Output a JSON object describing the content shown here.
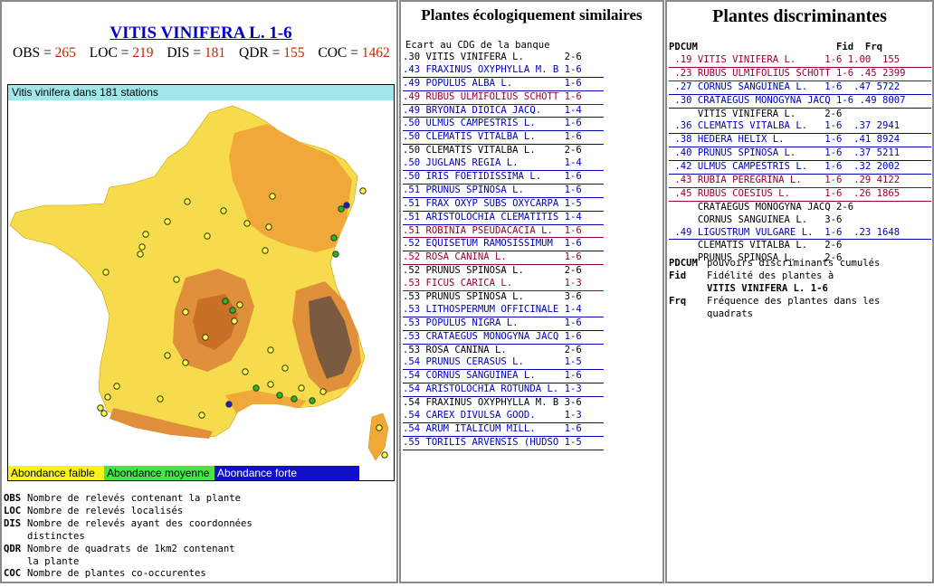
{
  "left": {
    "title": "VITIS VINIFERA L. 1-6",
    "stats": [
      {
        "label": "OBS",
        "value": "265"
      },
      {
        "label": "LOC",
        "value": "219"
      },
      {
        "label": "DIS",
        "value": "181"
      },
      {
        "label": "QDR",
        "value": "155"
      },
      {
        "label": "COC",
        "value": "1462"
      }
    ],
    "map_header": "Vitis vinifera dans 181 stations",
    "legend": {
      "faible": "Abondance faible",
      "moyenne": "Abondance moyenne",
      "forte": "Abondance forte"
    },
    "abbreviations": [
      {
        "k": "OBS",
        "v": "Nombre de relevés contenant la plante"
      },
      {
        "k": "LOC",
        "v": "Nombre de relevés localisés"
      },
      {
        "k": "DIS",
        "v": "Nombre de relevés ayant des coordonnées"
      },
      {
        "k": "",
        "v": "distinctes"
      },
      {
        "k": "QDR",
        "v": "Nombre de quadrats de 1km2 contenant"
      },
      {
        "k": "",
        "v": "la plante"
      },
      {
        "k": "COC",
        "v": "Nombre de plantes co-occurentes"
      }
    ]
  },
  "similar": {
    "title": "Plantes écologiquement similaires",
    "header": "Ecart au CDG de la banque",
    "rows": [
      {
        "t": ".30 VITIS VINIFERA L.       2-6",
        "c": "black"
      },
      {
        "t": ".43 FRAXINUS OXYPHYLLA M. B 1-6",
        "c": "blue"
      },
      {
        "t": ".49 POPULUS ALBA L.         1-6",
        "c": "blue"
      },
      {
        "t": ".49 RUBUS ULMIFOLIUS SCHOTT 1-6",
        "c": "maroon"
      },
      {
        "t": ".49 BRYONIA DIOICA JACQ.    1-4",
        "c": "blue"
      },
      {
        "t": ".50 ULMUS CAMPESTRIS L.     1-6",
        "c": "blue"
      },
      {
        "t": ".50 CLEMATIS VITALBA L.     1-6",
        "c": "blue"
      },
      {
        "t": ".50 CLEMATIS VITALBA L.     2-6",
        "c": "black"
      },
      {
        "t": ".50 JUGLANS REGIA L.        1-4",
        "c": "blue"
      },
      {
        "t": ".50 IRIS FOETIDISSIMA L.    1-6",
        "c": "blue"
      },
      {
        "t": ".51 PRUNUS SPINOSA L.       1-6",
        "c": "blue"
      },
      {
        "t": ".51 FRAX OXYP SUBS OXYCARPA 1-5",
        "c": "blue"
      },
      {
        "t": ".51 ARISTOLOCHIA CLEMATITIS 1-4",
        "c": "blue"
      },
      {
        "t": ".51 ROBINIA PSEUDACACIA L.  1-6",
        "c": "maroon"
      },
      {
        "t": ".52 EQUISETUM RAMOSISSIMUM  1-6",
        "c": "blue"
      },
      {
        "t": ".52 ROSA CANINA L.          1-6",
        "c": "maroon"
      },
      {
        "t": ".52 PRUNUS SPINOSA L.       2-6",
        "c": "black"
      },
      {
        "t": ".53 FICUS CARICA L.         1-3",
        "c": "maroon"
      },
      {
        "t": ".53 PRUNUS SPINOSA L.       3-6",
        "c": "black"
      },
      {
        "t": ".53 LITHOSPERMUM OFFICINALE 1-4",
        "c": "blue"
      },
      {
        "t": ".53 POPULUS NIGRA L.        1-6",
        "c": "blue"
      },
      {
        "t": ".53 CRATAEGUS MONOGYNA JACQ 1-6",
        "c": "blue"
      },
      {
        "t": ".53 ROSA CANINA L.          2-6",
        "c": "black"
      },
      {
        "t": ".54 PRUNUS CERASUS L.       1-5",
        "c": "blue"
      },
      {
        "t": ".54 CORNUS SANGUINEA L.     1-6",
        "c": "blue"
      },
      {
        "t": ".54 ARISTOLOCHIA ROTUNDA L. 1-3",
        "c": "blue"
      },
      {
        "t": ".54 FRAXINUS OXYPHYLLA M. B 3-6",
        "c": "black"
      },
      {
        "t": ".54 CAREX DIVULSA GOOD.     1-3",
        "c": "blue"
      },
      {
        "t": ".54 ARUM ITALICUM MILL.     1-6",
        "c": "blue"
      },
      {
        "t": ".55 TORILIS ARVENSIS (HUDSO 1-5",
        "c": "blue"
      }
    ]
  },
  "discrim": {
    "title": "Plantes discriminantes",
    "header": "PDCUM                        Fid  Frq",
    "rows": [
      {
        "t": " .19 VITIS VINIFERA L.     1-6 1.00  155",
        "c": "maroon"
      },
      {
        "t": " .23 RUBUS ULMIFOLIUS SCHOTT 1-6 .45 2399",
        "c": "maroon"
      },
      {
        "t": " .27 CORNUS SANGUINEA L.   1-6  .47 5722",
        "c": "blue"
      },
      {
        "t": " .30 CRATAEGUS MONOGYNA JACQ 1-6 .49 8007",
        "c": "blue"
      },
      {
        "t": "     VITIS VINIFERA L.     2-6",
        "c": "black"
      },
      {
        "t": " .36 CLEMATIS VITALBA L.   1-6  .37 2941",
        "c": "blue"
      },
      {
        "t": " .38 HEDERA HELIX L.       1-6  .41 8924",
        "c": "blue"
      },
      {
        "t": " .40 PRUNUS SPINOSA L.     1-6  .37 5211",
        "c": "blue"
      },
      {
        "t": " .42 ULMUS CAMPESTRIS L.   1-6  .32 2002",
        "c": "blue"
      },
      {
        "t": " .43 RUBIA PEREGRINA L.    1-6  .29 4122",
        "c": "maroon"
      },
      {
        "t": " .45 RUBUS COESIUS L.      1-6  .26 1865",
        "c": "maroon"
      },
      {
        "t": "     CRATAEGUS MONOGYNA JACQ 2-6",
        "c": "black"
      },
      {
        "t": "     CORNUS SANGUINEA L.   3-6",
        "c": "black"
      },
      {
        "t": " .49 LIGUSTRUM VULGARE L.  1-6  .23 1648",
        "c": "blue"
      },
      {
        "t": "     CLEMATIS VITALBA L.   2-6",
        "c": "black"
      },
      {
        "t": "     PRUNUS SPINOSA L.     2-6",
        "c": "black"
      }
    ],
    "notes": [
      {
        "k": "PDCUM",
        "v": "pouvoirs discriminants cumulés",
        "b": false
      },
      {
        "k": "Fid",
        "v": "Fidélité des plantes à",
        "b": false
      },
      {
        "k": "",
        "v": "VITIS VINIFERA L.      1-6",
        "b": true
      },
      {
        "k": "Frq",
        "v": "Fréquence des plantes dans les",
        "b": false
      },
      {
        "k": "",
        "v": "quadrats",
        "b": false
      }
    ]
  },
  "colors": {
    "link_blue": "#0000bb",
    "maroon": "#990033",
    "stat_red": "#cc2200",
    "map_header": "#9fe7ea"
  }
}
